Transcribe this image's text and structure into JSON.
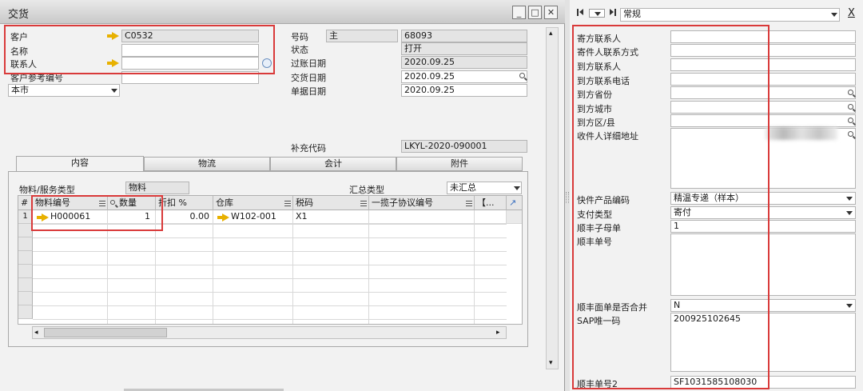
{
  "window": {
    "title": "交货"
  },
  "header": {
    "customer_label": "客户",
    "customer_value": "C0532",
    "name_label": "名称",
    "name_value": "",
    "contact_label": "联系人",
    "contact_value": "",
    "ref_label": "客户参考编号",
    "ref_value": "",
    "currency_value": "本市",
    "number_label": "号码",
    "number_series": "主",
    "number_value": "68093",
    "status_label": "状态",
    "status_value": "打开",
    "posting_label": "过账日期",
    "posting_value": "2020.09.25",
    "delivery_label": "交货日期",
    "delivery_value": "2020.09.25",
    "doc_label": "单据日期",
    "doc_value": "2020.09.25",
    "supp_label": "补充代码",
    "supp_value": "LKYL-2020-090001"
  },
  "tabs": [
    "内容",
    "物流",
    "会计",
    "附件"
  ],
  "content": {
    "item_type_label": "物料/服务类型",
    "item_type_value": "物料",
    "summary_label": "汇总类型",
    "summary_value": "未汇总"
  },
  "grid": {
    "headers": [
      "#",
      "物料编号",
      "数量",
      "折扣 %",
      "仓库",
      "税码",
      "一揽子协议编号",
      "【..."
    ],
    "rows": [
      {
        "num": "1",
        "item": "H000061",
        "qty": "1",
        "disc": "0.00",
        "wh": "W102-001",
        "tax": "X1",
        "blanket": ""
      }
    ]
  },
  "right_panel": {
    "nav_value": "常规",
    "close_label": "X",
    "fields": [
      {
        "label": "寄方联系人",
        "value": ""
      },
      {
        "label": "寄件人联系方式",
        "value": ""
      },
      {
        "label": "到方联系人",
        "value": ""
      },
      {
        "label": "到方联系电话",
        "value": ""
      },
      {
        "label": "到方省份",
        "value": ""
      },
      {
        "label": "到方城市",
        "value": ""
      },
      {
        "label": "到方区/县",
        "value": ""
      },
      {
        "label": "收件人详细地址",
        "value": ""
      },
      {
        "label": "快件产品编码",
        "value": "精温专递（样本）"
      },
      {
        "label": "支付类型",
        "value": "寄付"
      },
      {
        "label": "顺丰子母单",
        "value": "1"
      },
      {
        "label": "顺丰单号",
        "value": ""
      },
      {
        "label": "顺丰面单是否合并",
        "value": "N"
      },
      {
        "label": "SAP唯一码",
        "value": "200925102645"
      },
      {
        "label": "顺丰单号2",
        "value": "SF1031585108030"
      }
    ]
  },
  "colors": {
    "highlight": "#d93a3a",
    "link_arrow": "#e8b100"
  }
}
